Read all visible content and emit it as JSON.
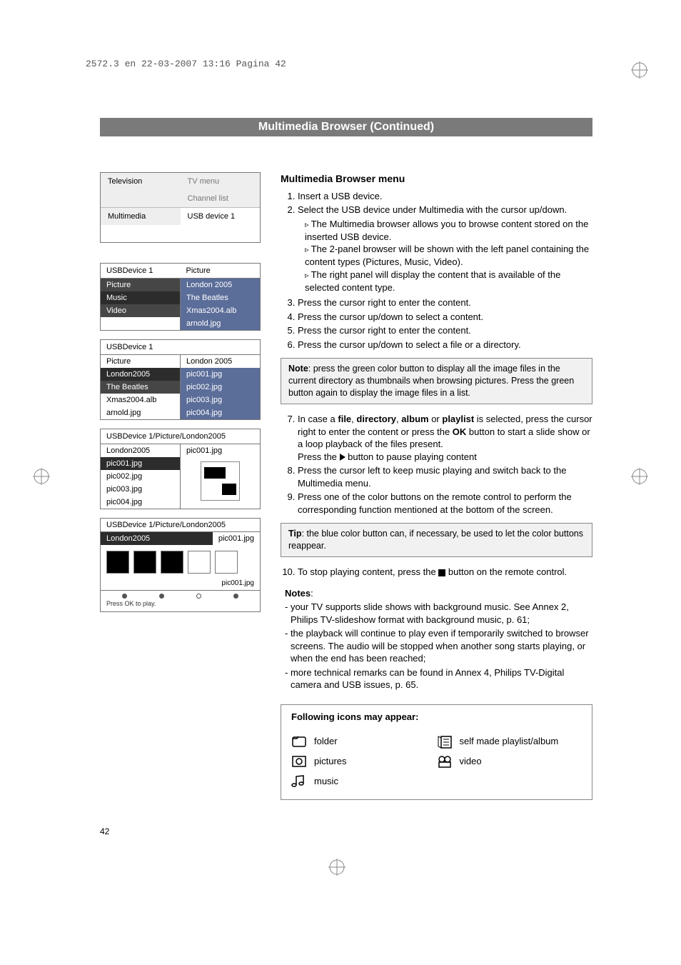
{
  "print_header": "2572.3 en  22-03-2007  13:16  Pagina 42",
  "page_number": "42",
  "title_bar": "Multimedia Browser  (Continued)",
  "tvmenu": {
    "television": "Television",
    "tvmenu": "TV menu",
    "channel_list": "Channel list",
    "multimedia": "Multimedia",
    "usb": "USB device 1"
  },
  "browser1": {
    "header_left": "USBDevice 1",
    "header_right": "Picture",
    "left": [
      "Picture",
      "Music",
      "Video"
    ],
    "right": [
      "London 2005",
      "The Beatles",
      "Xmas2004.alb",
      "arnold.jpg"
    ]
  },
  "browser2": {
    "header_left": "USBDevice 1",
    "left": [
      "Picture",
      "London2005",
      "The Beatles",
      "Xmas2004.alb",
      "arnold.jpg"
    ],
    "right_head": "London 2005",
    "right": [
      "pic001.jpg",
      "pic002.jpg",
      "pic003.jpg",
      "pic004.jpg"
    ]
  },
  "browser3": {
    "path": "USBDevice 1/Picture/London2005",
    "left_head": "London2005",
    "right_head": "pic001.jpg",
    "left": [
      "pic001.jpg",
      "pic002.jpg",
      "pic003.jpg",
      "pic004.jpg"
    ]
  },
  "browser4": {
    "path": "USBDevice 1/Picture/London2005",
    "left": "London2005",
    "right": "pic001.jpg",
    "thumb_label": "pic001.jpg",
    "hint": "Press OK to play."
  },
  "right": {
    "h1": "Multimedia Browser menu",
    "steps1": [
      "Insert a USB device.",
      "Select the USB device under Multimedia with the cursor up/down."
    ],
    "sub1": [
      "The Multimedia browser allows you to browse content stored on the inserted USB device.",
      "The 2-panel browser will be shown with the left panel containing the content types (Pictures, Music, Video).",
      "The right panel will display the content that is available of the selected content type."
    ],
    "steps2": [
      "Press the cursor right to enter the content.",
      "Press the cursor up/down to select a content.",
      "Press the cursor right to enter the content.",
      "Press the cursor up/down to select a file or a directory."
    ],
    "note1_pre": "Note",
    "note1": ": press the green color button to display all the image files in the current directory as thumbnails when browsing pictures. Press the green button again to display the image files in a list.",
    "step7_a": "In case a ",
    "step7_b1": "file",
    "step7_b2": "directory",
    "step7_b3": "album",
    "step7_b4": "playlist",
    "step7_c": " is selected, press the cursor right to enter the content or press the ",
    "step7_ok": "OK",
    "step7_d": " button to start a slide show or a loop playback of the files present.",
    "step7_e": "Press the ",
    "step7_f": " button to pause playing content",
    "step8": "Press the cursor left to keep music playing and switch back to the Multimedia menu.",
    "step9": "Press one of the color buttons on the remote control to perform the corresponding function mentioned at the bottom of the screen.",
    "tip_pre": "Tip",
    "tip": ": the blue color button can, if necessary, be used to let the color buttons reappear.",
    "step10_a": "To stop playing content, press the ",
    "step10_b": " button on the remote control.",
    "notes_head": "Notes",
    "notes": [
      "- your TV supports slide shows with background music. See Annex 2, Philips TV-slideshow format with background music, p. 61;",
      "- the playback will continue to play even if temporarily switched to browser screens. The audio will be stopped when another song starts playing, or when the end has been reached;",
      "- more technical remarks can be found in Annex 4, Philips TV-Digital camera and USB issues, p. 65."
    ],
    "icons_head": "Following icons may appear:",
    "icons": {
      "folder": "folder",
      "pictures": "pictures",
      "music": "music",
      "playlist": "self made playlist/album",
      "video": "video"
    }
  }
}
